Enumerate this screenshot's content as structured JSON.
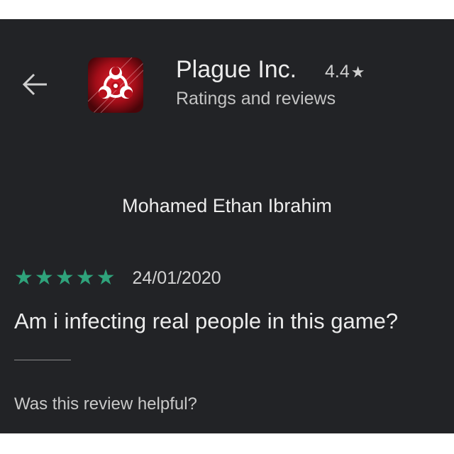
{
  "header": {
    "app_name": "Plague Inc.",
    "app_rating": "4.4",
    "rating_star": "★",
    "subtitle": "Ratings and reviews",
    "back_icon": "arrow-left-icon",
    "app_icon": "biohazard-icon"
  },
  "review": {
    "reviewer_name": "Mohamed Ethan Ibrahim",
    "stars": 5,
    "star_glyph": "★",
    "date": "24/01/2020",
    "text": "Am i infecting real people in this game?",
    "helpful_prompt": "Was this review helpful?"
  },
  "colors": {
    "background": "#222326",
    "star_green": "#2fa37b",
    "app_icon_red": "#c4121f"
  }
}
